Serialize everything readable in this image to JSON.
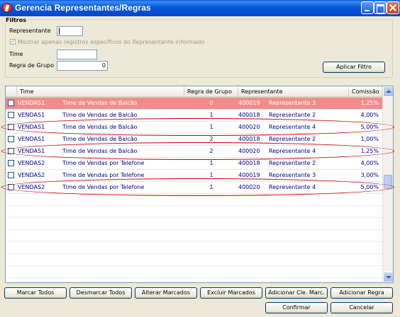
{
  "window": {
    "title": "Gerencia Representantes/Regras"
  },
  "filters": {
    "group_title": "Filtros",
    "representante_label": "Representante",
    "representante_value": "",
    "only_specific_label": "Mostrar apenas registros específicos do Representante informado",
    "only_specific_checked": true,
    "time_label": "Time",
    "time_value": "",
    "regra_label": "Regra de Grupo",
    "regra_value": "0",
    "apply_button": "Aplicar Filtro"
  },
  "grid": {
    "columns": [
      "Time",
      "Regra de Grupo",
      "Representante",
      "Comissão"
    ],
    "rows": [
      {
        "time": "VENDAS1",
        "time_desc": "Time de Vendas de Balcão",
        "regra": "0",
        "rep_code": "400019",
        "rep_name": "Representante 3",
        "comissao": "1,25%",
        "selected": true,
        "highlighted": false
      },
      {
        "time": "VENDAS1",
        "time_desc": "Time de Vendas de Balcão",
        "regra": "1",
        "rep_code": "400018",
        "rep_name": "Representante 2",
        "comissao": "4,00%",
        "selected": false,
        "highlighted": false
      },
      {
        "time": "VENDAS1",
        "time_desc": "Time de Vendas de Balcão",
        "regra": "1",
        "rep_code": "400020",
        "rep_name": "Representante 4",
        "comissao": "5,00%",
        "selected": false,
        "highlighted": true
      },
      {
        "time": "VENDAS1",
        "time_desc": "Time de Vendas de Balcão",
        "regra": "2",
        "rep_code": "400018",
        "rep_name": "Representante 2",
        "comissao": "1,00%",
        "selected": false,
        "highlighted": false
      },
      {
        "time": "VENDAS1",
        "time_desc": "Time de Vendas de Balcão",
        "regra": "2",
        "rep_code": "400020",
        "rep_name": "Representante 4",
        "comissao": "1,25%",
        "selected": false,
        "highlighted": true
      },
      {
        "time": "VENDAS2",
        "time_desc": "Time de Vendas por Telefone",
        "regra": "1",
        "rep_code": "400018",
        "rep_name": "Representante 2",
        "comissao": "4,00%",
        "selected": false,
        "highlighted": false
      },
      {
        "time": "VENDAS2",
        "time_desc": "Time de Vendas por Telefone",
        "regra": "1",
        "rep_code": "400019",
        "rep_name": "Representante 3",
        "comissao": "3,00%",
        "selected": false,
        "highlighted": false
      },
      {
        "time": "VENDAS2",
        "time_desc": "Time de Vendas por Telefone",
        "regra": "1",
        "rep_code": "400020",
        "rep_name": "Representante 4",
        "comissao": "5,00%",
        "selected": false,
        "highlighted": true
      }
    ]
  },
  "buttons": {
    "marcar_todos": "Marcar Todos",
    "desmarcar_todos": "Desmarcar Todos",
    "alterar_marcados": "Alterar Marcados",
    "excluir_marcados": "Excluir Marcados",
    "adicionar_cle_marc": "Adicionar Cle. Marc.",
    "adicionar_regra": "Adicionar Regra",
    "confirmar": "Confirmar",
    "cancelar": "Cancelar"
  },
  "colors": {
    "selected_row": "#f28c8c",
    "highlight": "#d00000",
    "link_text": "#00008b"
  }
}
